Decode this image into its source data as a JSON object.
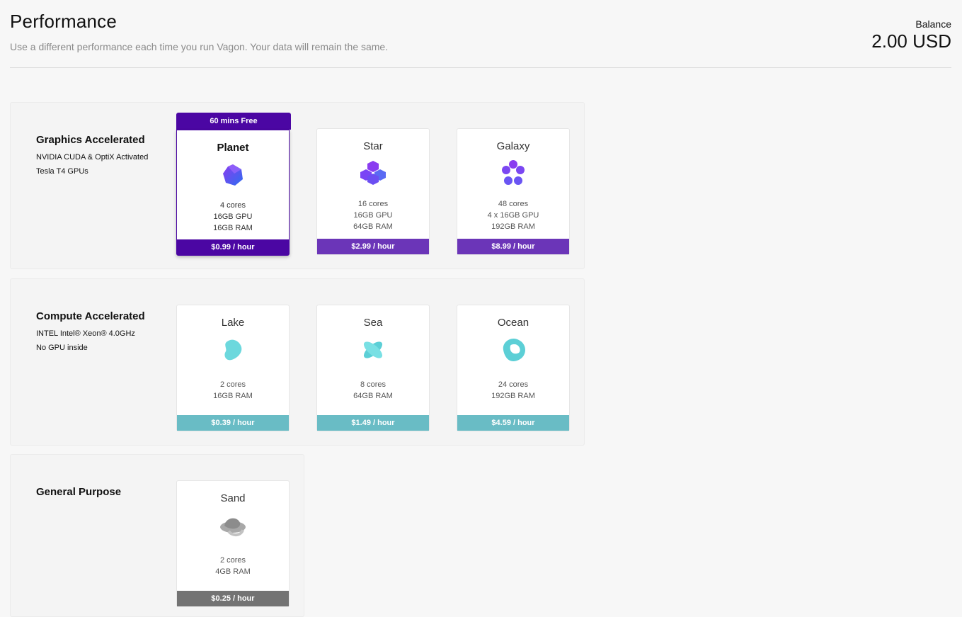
{
  "header": {
    "title": "Performance",
    "subtitle": "Use a different performance each time you run Vagon. Your data will remain the same.",
    "balance_label": "Balance",
    "balance_value": "2.00 USD"
  },
  "groups": [
    {
      "title": "Graphics Accelerated",
      "lines": [
        "NVIDIA CUDA & OptiX Activated",
        "Tesla T4 GPUs"
      ],
      "badge": "60 mins Free",
      "cards": [
        {
          "name": "Planet",
          "specs": [
            "4 cores",
            "16GB GPU",
            "16GB RAM"
          ],
          "price": "$0.99 / hour",
          "icon": "planet-icon",
          "selected": true
        },
        {
          "name": "Star",
          "specs": [
            "16 cores",
            "16GB GPU",
            "64GB RAM"
          ],
          "price": "$2.99 / hour",
          "icon": "star-icon"
        },
        {
          "name": "Galaxy",
          "specs": [
            "48 cores",
            "4 x 16GB GPU",
            "192GB RAM"
          ],
          "price": "$8.99 / hour",
          "icon": "galaxy-icon"
        }
      ]
    },
    {
      "title": "Compute Accelerated",
      "lines": [
        "INTEL Intel® Xeon® 4.0GHz",
        "No GPU inside"
      ],
      "cards": [
        {
          "name": "Lake",
          "specs": [
            "2 cores",
            "16GB RAM"
          ],
          "price": "$0.39 / hour",
          "icon": "lake-icon"
        },
        {
          "name": "Sea",
          "specs": [
            "8 cores",
            "64GB RAM"
          ],
          "price": "$1.49 / hour",
          "icon": "sea-icon"
        },
        {
          "name": "Ocean",
          "specs": [
            "24 cores",
            "192GB RAM"
          ],
          "price": "$4.59 / hour",
          "icon": "ocean-icon"
        }
      ]
    },
    {
      "title": "General Purpose",
      "lines": [],
      "cards": [
        {
          "name": "Sand",
          "specs": [
            "2 cores",
            "4GB RAM"
          ],
          "price": "$0.25 / hour",
          "icon": "sand-icon"
        }
      ]
    }
  ],
  "colors": {
    "graphics_price": "#6b35b8",
    "graphics_selected": "#4b06a3",
    "compute_price": "#69bcc5",
    "general_price": "#737373"
  }
}
